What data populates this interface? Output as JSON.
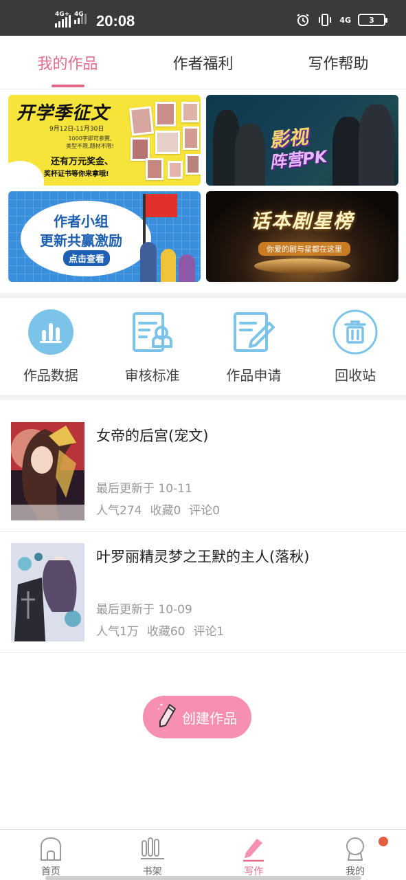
{
  "status_bar": {
    "signal1_label": "4G+",
    "signal2_label": "4G",
    "time": "20:08",
    "net_label": "4G",
    "battery": "3"
  },
  "tabs": [
    {
      "label": "我的作品",
      "active": true
    },
    {
      "label": "作者福利",
      "active": false
    },
    {
      "label": "写作帮助",
      "active": false
    }
  ],
  "banners": {
    "b1": {
      "title": "开学季征文",
      "dates": "9月12日-11月30日",
      "sub": "1000字即可参赛,类型不限,题材不限!",
      "prize": "还有万元奖金、",
      "prize2": "奖杯证书等你来拿哦!"
    },
    "b2": {
      "title": "影视",
      "title2": "阵营PK"
    },
    "b3": {
      "line1": "作者小组",
      "line2": "更新共赢激励",
      "button": "点击查看"
    },
    "b4": {
      "title": "话本剧星榜",
      "sub": "你爱的剧与星都在这里"
    }
  },
  "quick_actions": [
    {
      "label": "作品数据",
      "icon": "bar-chart-icon"
    },
    {
      "label": "审核标准",
      "icon": "review-standard-icon"
    },
    {
      "label": "作品申请",
      "icon": "edit-document-icon"
    },
    {
      "label": "回收站",
      "icon": "trash-icon"
    }
  ],
  "works": [
    {
      "title": "女帝的后宫(宠文)",
      "updated": "最后更新于 10-11",
      "popularity": "人气274",
      "favorites": "收藏0",
      "comments": "评论0"
    },
    {
      "title": "叶罗丽精灵梦之王默的主人(落秋)",
      "updated": "最后更新于 10-09",
      "popularity": "人气1万",
      "favorites": "收藏60",
      "comments": "评论1"
    }
  ],
  "create_button": {
    "label": "创建作品"
  },
  "bottom_nav": [
    {
      "label": "首页",
      "icon": "home-icon",
      "active": false
    },
    {
      "label": "书架",
      "icon": "bookshelf-icon",
      "active": false
    },
    {
      "label": "写作",
      "icon": "pen-icon",
      "active": true
    },
    {
      "label": "我的",
      "icon": "profile-icon",
      "active": false
    }
  ],
  "colors": {
    "accent": "#e56a8a",
    "create_button": "#f78fb0",
    "icon_blue": "#7cc3ea",
    "badge": "#e25e3e"
  }
}
